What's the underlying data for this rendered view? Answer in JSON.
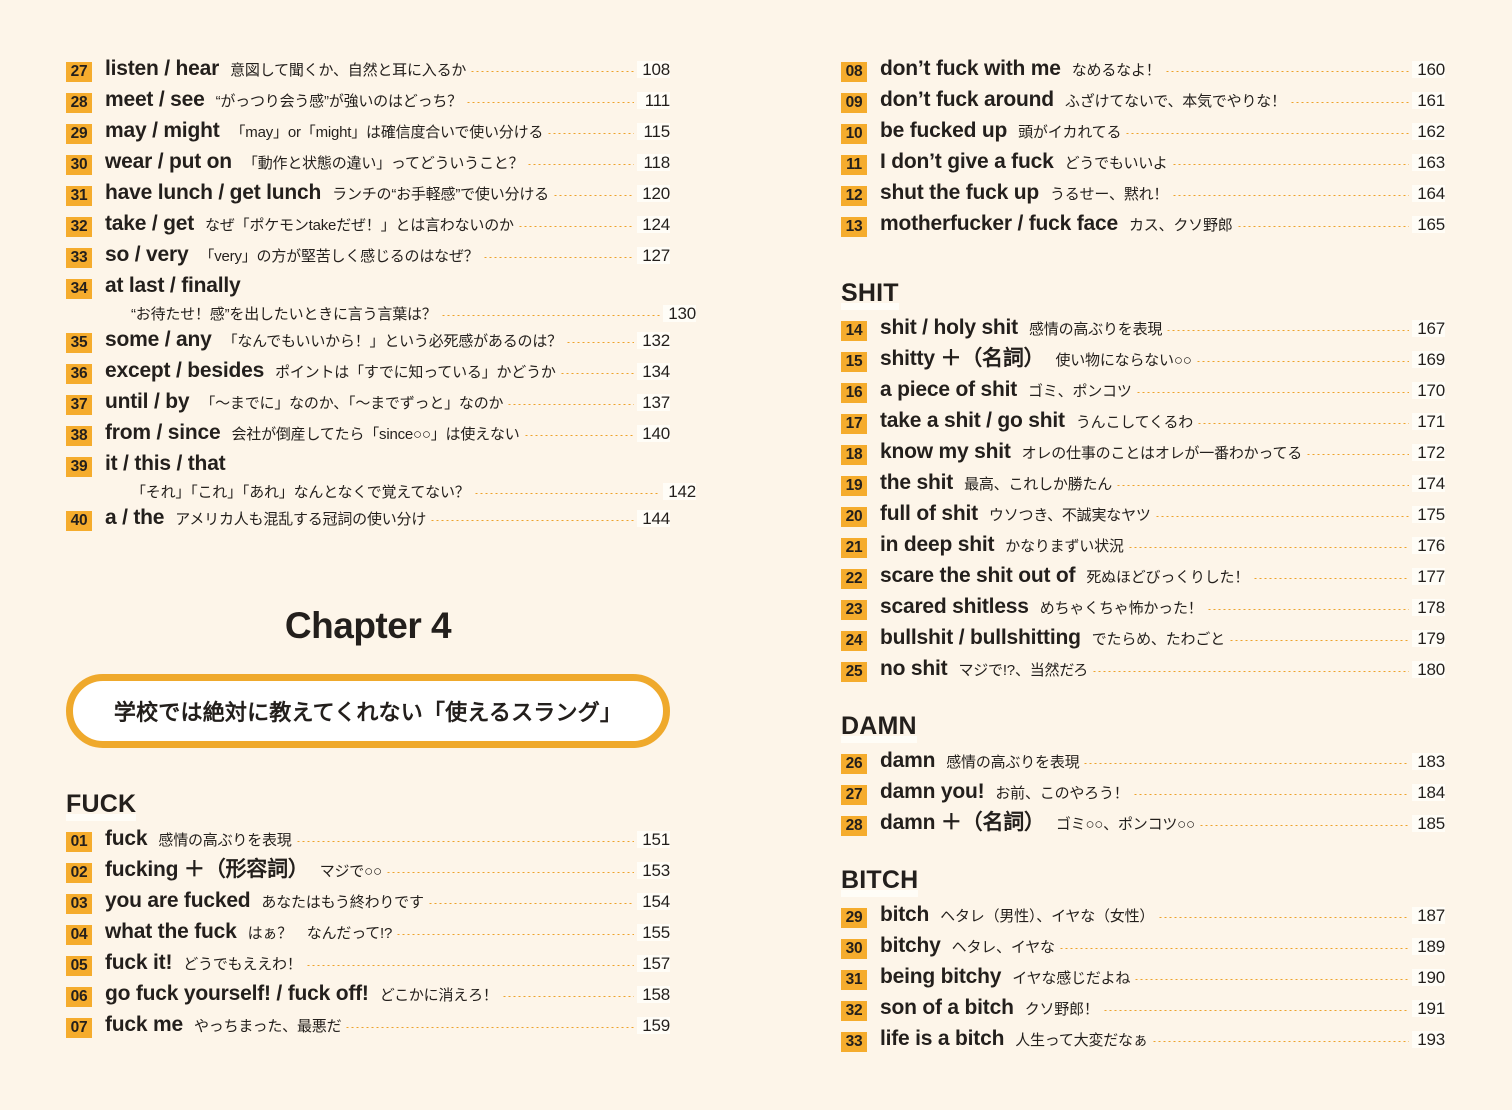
{
  "theme": {
    "background": "#fdf5e9",
    "badge_bg": "#f5ac2d",
    "accent": "#efa92c",
    "leader_dot": "#eda22b",
    "text": "#231f1c"
  },
  "left_column": {
    "entries": [
      {
        "num": "27",
        "term": "listen / hear",
        "gloss": "意図して聞くか、自然と耳に入るか",
        "page": "108"
      },
      {
        "num": "28",
        "term": "meet / see",
        "gloss": "“がっつり会う感”が強いのはどっち？",
        "page": "111"
      },
      {
        "num": "29",
        "term": "may / might",
        "gloss": "「may」or「might」は確信度合いで使い分ける",
        "page": "115"
      },
      {
        "num": "30",
        "term": "wear / put on",
        "gloss": "「動作と状態の違い」ってどういうこと？",
        "page": "118"
      },
      {
        "num": "31",
        "term": "have lunch / get lunch",
        "gloss": "ランチの“お手軽感”で使い分ける",
        "page": "120"
      },
      {
        "num": "32",
        "term": "take / get",
        "gloss": "なぜ「ポケモンtakeだぜ！」とは言わないのか",
        "page": "124"
      },
      {
        "num": "33",
        "term": "so / very",
        "gloss": "「very」の方が堅苦しく感じるのはなぜ？",
        "page": "127"
      },
      {
        "num": "34",
        "term": "at last / finally",
        "gloss": "“お待たせ！感”を出したいときに言う言葉は？",
        "page": "130",
        "wrapped": true
      },
      {
        "num": "35",
        "term": "some / any",
        "gloss": "「なんでもいいから！」という必死感があるのは？",
        "page": "132"
      },
      {
        "num": "36",
        "term": "except / besides",
        "gloss": "ポイントは「すでに知っている」かどうか",
        "page": "134"
      },
      {
        "num": "37",
        "term": "until / by",
        "gloss": "「〜までに」なのか、「〜までずっと」なのか",
        "page": "137"
      },
      {
        "num": "38",
        "term": "from / since",
        "gloss": "会社が倒産してたら「since○○」は使えない",
        "page": "140"
      },
      {
        "num": "39",
        "term": "it / this / that",
        "gloss": "「それ」「これ」「あれ」なんとなくで覚えてない？",
        "page": "142",
        "wrapped": true
      },
      {
        "num": "40",
        "term": "a / the",
        "gloss": "アメリカ人も混乱する冠詞の使い分け",
        "page": "144"
      }
    ],
    "chapter": {
      "title": "Chapter 4",
      "subtitle": "学校では絶対に教えてくれない「使えるスラング」"
    },
    "sections": [
      {
        "heading": "FUCK",
        "entries": [
          {
            "num": "01",
            "term": "fuck",
            "gloss": "感情の高ぶりを表現",
            "page": "151"
          },
          {
            "num": "02",
            "term": "fucking ＋（形容詞）",
            "gloss": "マジで○○",
            "page": "153"
          },
          {
            "num": "03",
            "term": "you are fucked",
            "gloss": "あなたはもう終わりです",
            "page": "154"
          },
          {
            "num": "04",
            "term": "what the fuck",
            "gloss": "はぁ？　なんだって!?",
            "page": "155"
          },
          {
            "num": "05",
            "term": "fuck it!",
            "gloss": "どうでもええわ！",
            "page": "157"
          },
          {
            "num": "06",
            "term": "go fuck yourself! / fuck off!",
            "gloss": "どこかに消えろ！",
            "page": "158"
          },
          {
            "num": "07",
            "term": "fuck me",
            "gloss": "やっちまった、最悪だ",
            "page": "159"
          }
        ]
      }
    ]
  },
  "right_column": {
    "top_entries": [
      {
        "num": "08",
        "term": "don’t fuck with me",
        "gloss": "なめるなよ！",
        "page": "160"
      },
      {
        "num": "09",
        "term": "don’t fuck around",
        "gloss": "ふざけてないで、本気でやりな！",
        "page": "161"
      },
      {
        "num": "10",
        "term": "be fucked up",
        "gloss": "頭がイカれてる",
        "page": "162"
      },
      {
        "num": "11",
        "term": "I don’t give a fuck",
        "gloss": "どうでもいいよ",
        "page": "163"
      },
      {
        "num": "12",
        "term": "shut the fuck up",
        "gloss": "うるせー、黙れ！",
        "page": "164"
      },
      {
        "num": "13",
        "term": "motherfucker / fuck face",
        "gloss": "カス、クソ野郎",
        "page": "165"
      }
    ],
    "sections": [
      {
        "heading": "SHIT",
        "entries": [
          {
            "num": "14",
            "term": "shit / holy shit",
            "gloss": "感情の高ぶりを表現",
            "page": "167"
          },
          {
            "num": "15",
            "term": "shitty ＋（名詞）",
            "gloss": "使い物にならない○○",
            "page": "169"
          },
          {
            "num": "16",
            "term": "a piece of shit",
            "gloss": "ゴミ、ポンコツ",
            "page": "170"
          },
          {
            "num": "17",
            "term": "take a shit / go shit",
            "gloss": "うんこしてくるわ",
            "page": "171"
          },
          {
            "num": "18",
            "term": "know my shit",
            "gloss": "オレの仕事のことはオレが一番わかってる",
            "page": "172"
          },
          {
            "num": "19",
            "term": "the shit",
            "gloss": "最高、これしか勝たん",
            "page": "174"
          },
          {
            "num": "20",
            "term": "full of shit",
            "gloss": "ウソつき、不誠実なヤツ",
            "page": "175"
          },
          {
            "num": "21",
            "term": "in deep shit",
            "gloss": "かなりまずい状況",
            "page": "176"
          },
          {
            "num": "22",
            "term": "scare the shit out of",
            "gloss": "死ぬほどびっくりした！",
            "page": "177"
          },
          {
            "num": "23",
            "term": "scared shitless",
            "gloss": "めちゃくちゃ怖かった！",
            "page": "178"
          },
          {
            "num": "24",
            "term": "bullshit / bullshitting",
            "gloss": "でたらめ、たわごと",
            "page": "179"
          },
          {
            "num": "25",
            "term": "no shit",
            "gloss": "マジで!?、当然だろ",
            "page": "180"
          }
        ]
      },
      {
        "heading": "DAMN",
        "entries": [
          {
            "num": "26",
            "term": "damn",
            "gloss": "感情の高ぶりを表現",
            "page": "183"
          },
          {
            "num": "27",
            "term": "damn you!",
            "gloss": "お前、このやろう！",
            "page": "184"
          },
          {
            "num": "28",
            "term": "damn ＋（名詞）",
            "gloss": "ゴミ○○、ポンコツ○○",
            "page": "185"
          }
        ]
      },
      {
        "heading": "BITCH",
        "entries": [
          {
            "num": "29",
            "term": "bitch",
            "gloss": "ヘタレ（男性）、イヤな（女性）",
            "page": "187"
          },
          {
            "num": "30",
            "term": "bitchy",
            "gloss": "ヘタレ、イヤな",
            "page": "189"
          },
          {
            "num": "31",
            "term": "being bitchy",
            "gloss": "イヤな感じだよね",
            "page": "190"
          },
          {
            "num": "32",
            "term": "son of a bitch",
            "gloss": "クソ野郎！",
            "page": "191"
          },
          {
            "num": "33",
            "term": "life is a bitch",
            "gloss": "人生って大変だなぁ",
            "page": "193"
          }
        ]
      }
    ]
  }
}
